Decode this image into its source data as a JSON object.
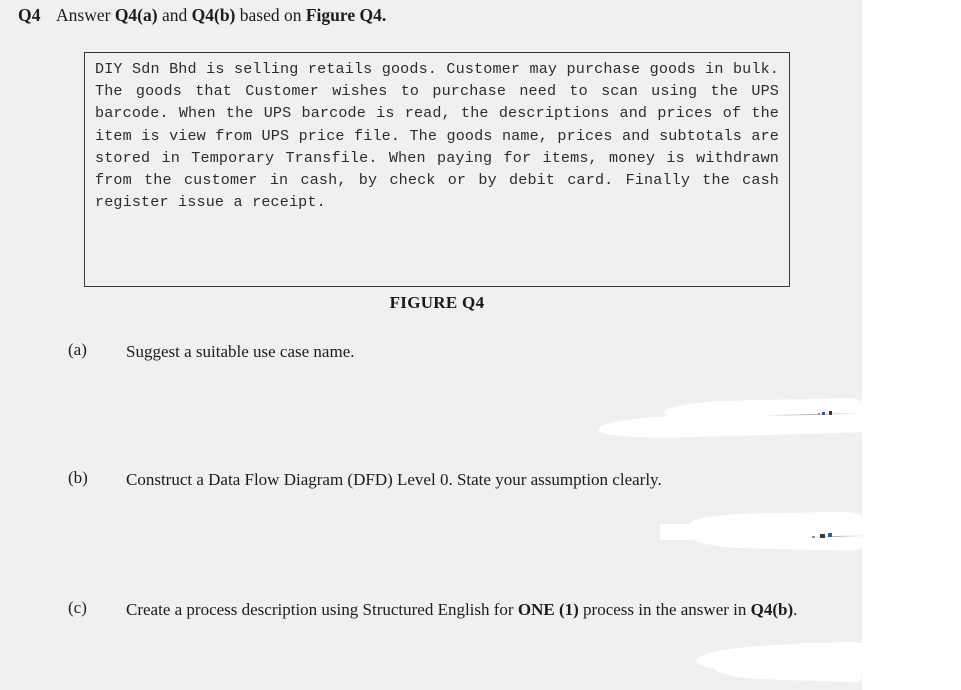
{
  "page": {
    "background_color": "#f0f0f0",
    "margin_color": "#ffffff",
    "text_color": "#1b1b22"
  },
  "question": {
    "number": "Q4",
    "stem_prefix": "Answer ",
    "stem_bold_1": "Q4(a)",
    "stem_mid": " and ",
    "stem_bold_2": "Q4(b)",
    "stem_suffix": " based on ",
    "stem_bold_3": "Figure Q4."
  },
  "figure": {
    "caption": "FIGURE Q4",
    "border_color": "#3a3a3a",
    "body": "DIY Sdn Bhd is selling retails goods. Customer may purchase goods in bulk. The goods that Customer wishes to purchase need to scan using the UPS barcode. When the UPS barcode is read, the descriptions and prices of the item is view from UPS price file. The goods name, prices and subtotals are stored in Temporary Transfile. When paying for items, money is withdrawn from the customer in cash, by check or by debit card. Finally the cash register issue a receipt.",
    "lines": [
      "DIY Sdn Bhd is selling retails goods. Customer may",
      "purchase goods in bulk. The goods that Customer wishes",
      "to purchase need to scan using the UPS barcode. When the",
      "UPS barcode is read, the descriptions and prices of the",
      "item is view from UPS price file. The goods name, prices",
      "and subtotals are stored in Temporary Transfile. When",
      "paying for items, money is withdrawn from the customer",
      "in cash, by check or by debit card. Finally the cash",
      "register issue a receipt."
    ]
  },
  "parts": {
    "a": {
      "label": "(a)",
      "text": "Suggest a suitable use case name."
    },
    "b": {
      "label": "(b)",
      "text": "Construct a Data Flow Diagram (DFD) Level 0. State your assumption clearly."
    },
    "c": {
      "label": "(c)",
      "text_1": "Create a process description using Structured English for ",
      "bold_1": "ONE (1)",
      "text_2": " process in the answer in ",
      "bold_2": "Q4(b)",
      "text_3": "."
    }
  }
}
